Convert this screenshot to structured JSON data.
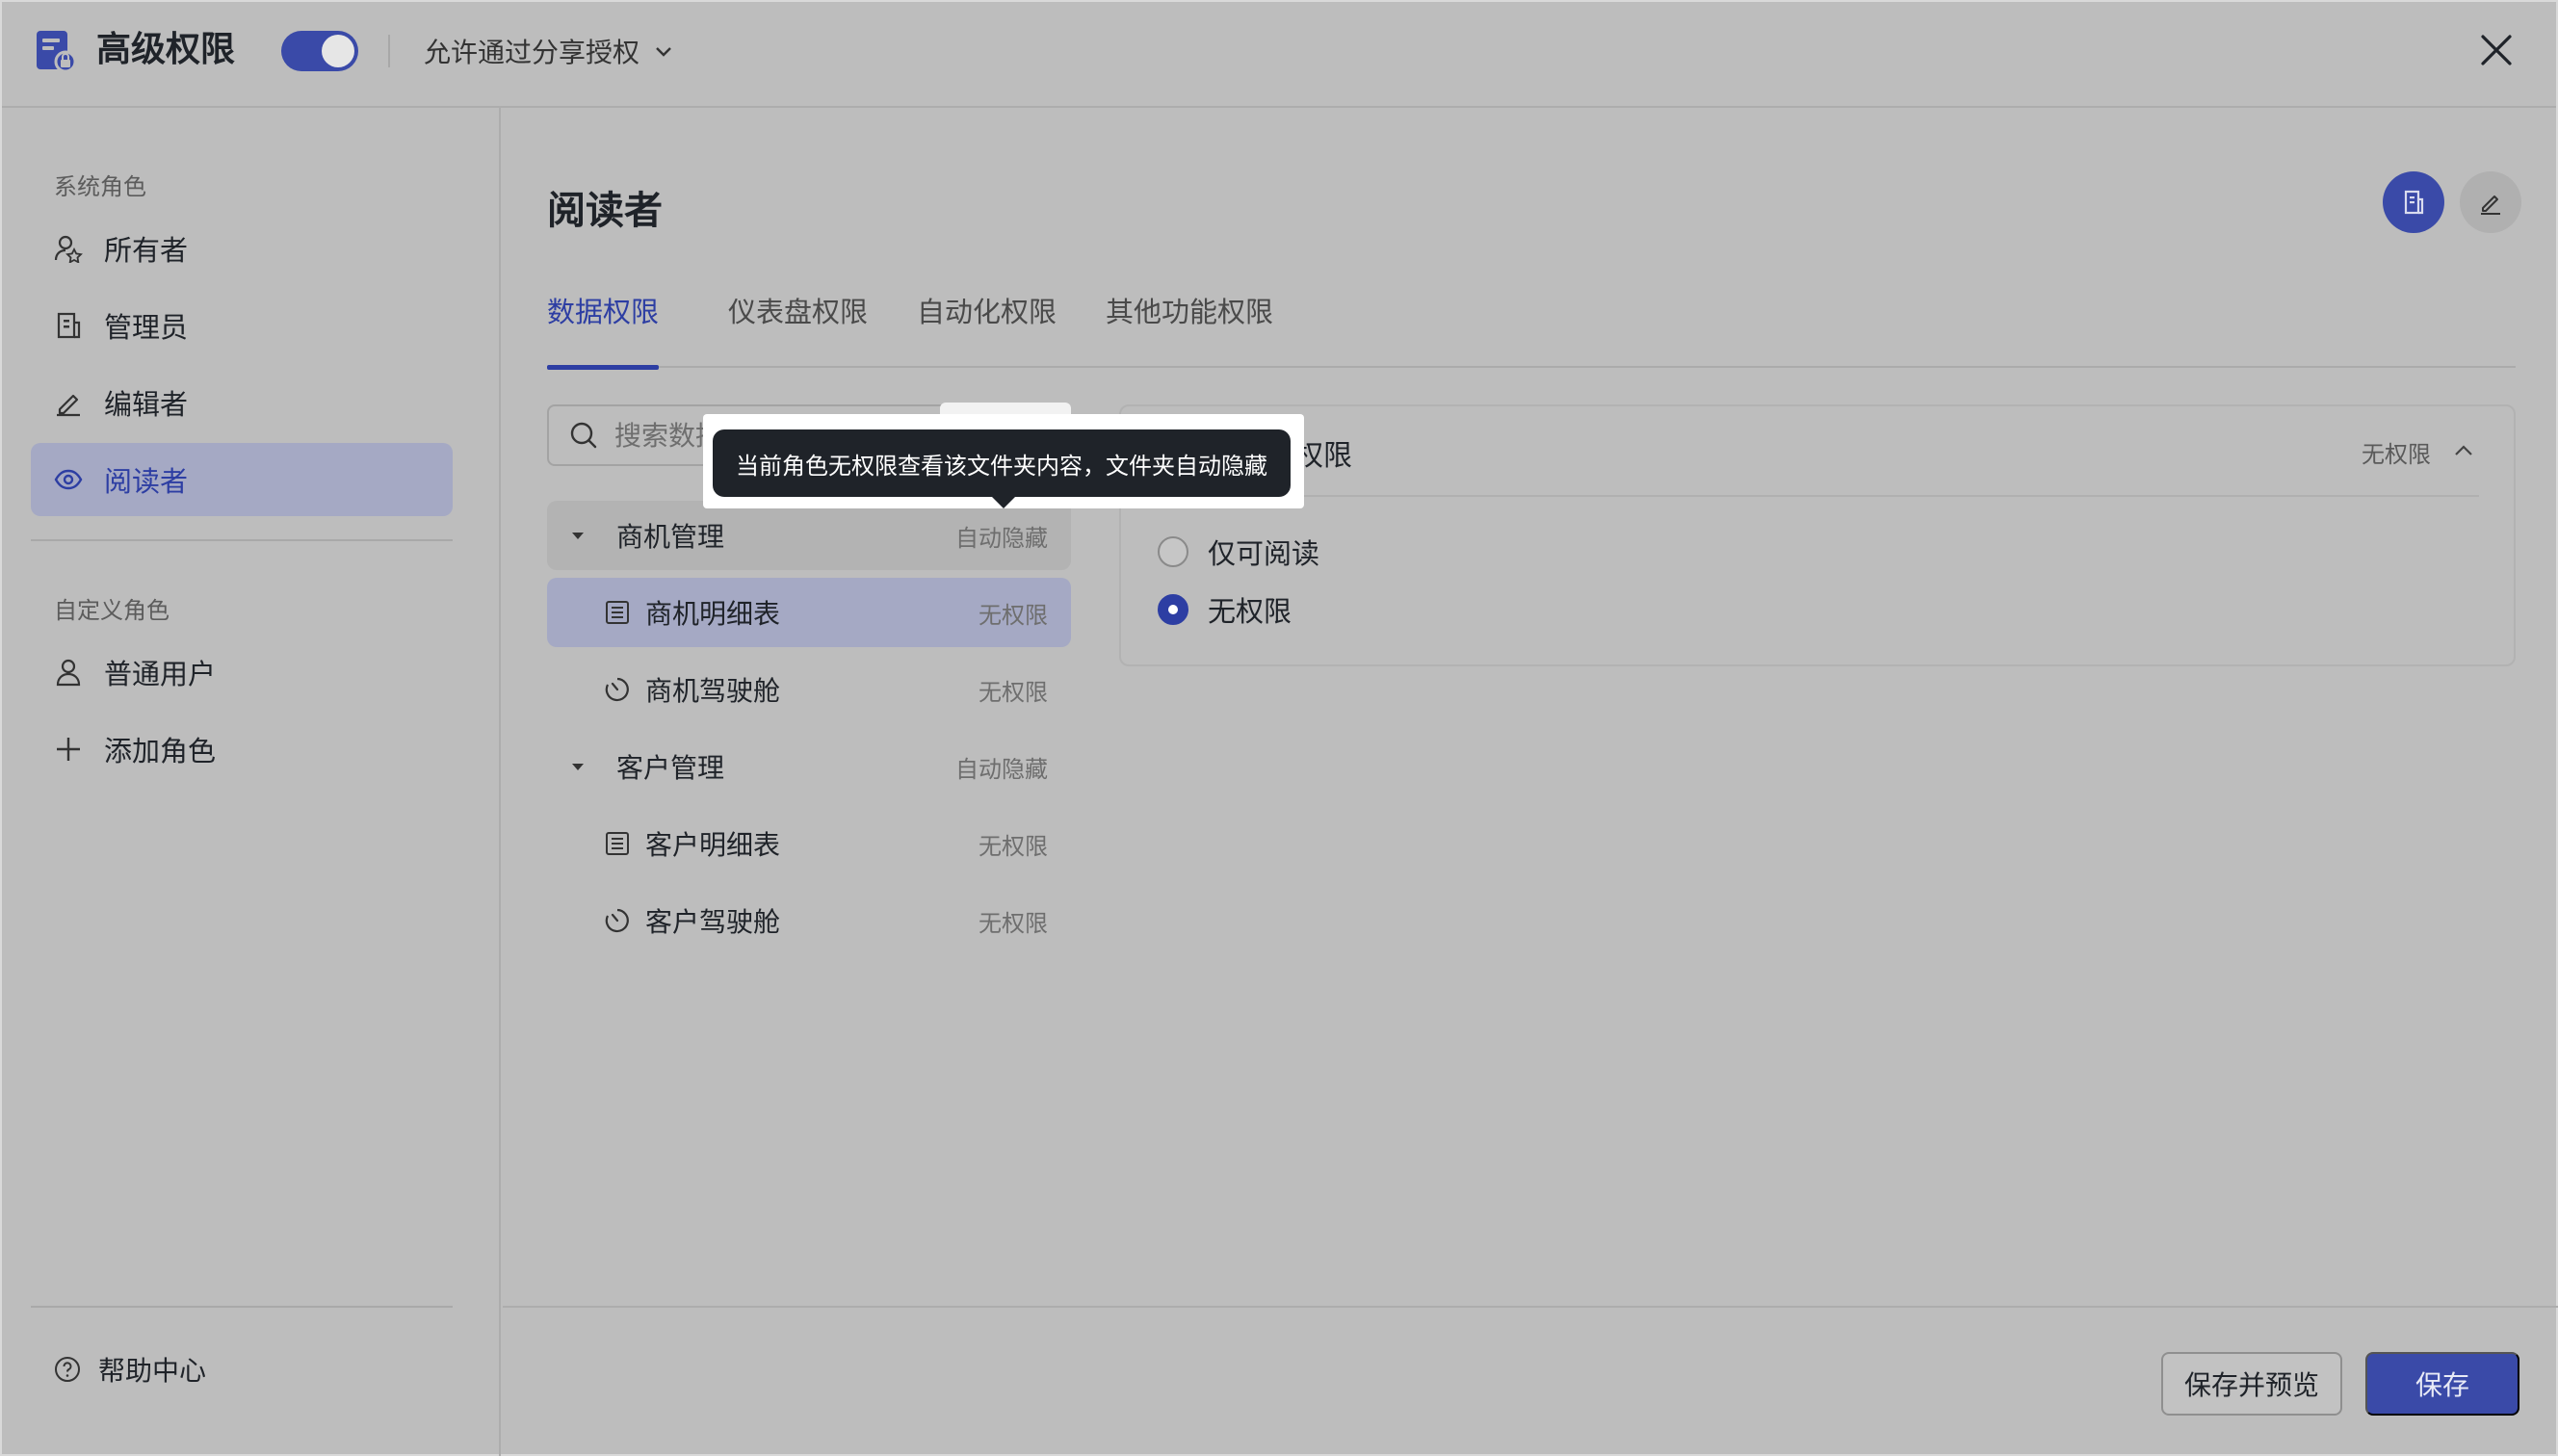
{
  "header": {
    "title": "高级权限",
    "share_label": "允许通过分享授权",
    "toggle_on": true
  },
  "sidebar": {
    "system_group": "系统角色",
    "system_roles": [
      {
        "label": "所有者",
        "icon": "owner-icon"
      },
      {
        "label": "管理员",
        "icon": "building-icon"
      },
      {
        "label": "编辑者",
        "icon": "pencil-icon"
      },
      {
        "label": "阅读者",
        "icon": "eye-icon",
        "active": true
      }
    ],
    "custom_group": "自定义角色",
    "custom_roles": [
      {
        "label": "普通用户",
        "icon": "user-icon"
      },
      {
        "label": "添加角色",
        "icon": "plus-icon"
      }
    ],
    "help": "帮助中心"
  },
  "main": {
    "title": "阅读者",
    "tabs": [
      "数据权限",
      "仪表盘权限",
      "自动化权限",
      "其他功能权限"
    ],
    "search_placeholder": "搜索数据表或仪表盘",
    "tree": [
      {
        "type": "folder",
        "label": "商机管理",
        "status": "自动隐藏"
      },
      {
        "type": "table",
        "label": "商机明细表",
        "status": "无权限",
        "selected": true
      },
      {
        "type": "dashboard",
        "label": "商机驾驶舱",
        "status": "无权限"
      },
      {
        "type": "folder",
        "label": "客户管理",
        "status": "自动隐藏"
      },
      {
        "type": "table",
        "label": "客户明细表",
        "status": "无权限"
      },
      {
        "type": "dashboard",
        "label": "客户驾驶舱",
        "status": "无权限"
      }
    ],
    "panel": {
      "title_visible": "权限",
      "status": "无权限",
      "options": [
        "仅可阅读",
        "无权限"
      ],
      "selected_option": "无权限"
    },
    "tooltip": "当前角色无权限查看该文件夹内容，文件夹自动隐藏",
    "hovered_chip": "自动隐藏"
  },
  "footer": {
    "save_preview": "保存并预览",
    "save": "保存"
  },
  "colors": {
    "accent": "#3a4aa8",
    "accent_text": "#2d3ea3",
    "overlay_bg": "#bdbdbd",
    "tooltip_bg": "#1f2329"
  }
}
